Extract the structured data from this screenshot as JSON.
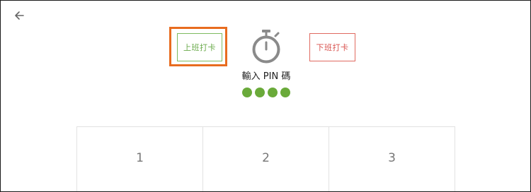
{
  "nav": {
    "back_icon": "arrow-left-icon"
  },
  "actions": {
    "clock_in_label": "上班打卡",
    "clock_out_label": "下班打卡",
    "clock_in_color": "#6aaa4a",
    "clock_out_color": "#d9534f",
    "highlight_color": "#e86c1f"
  },
  "pin": {
    "icon": "stopwatch-icon",
    "prompt": "輸入 PIN 碼",
    "entered_digits": 4,
    "dot_color": "#6aaa3a"
  },
  "keypad": {
    "keys": [
      "1",
      "2",
      "3"
    ]
  }
}
